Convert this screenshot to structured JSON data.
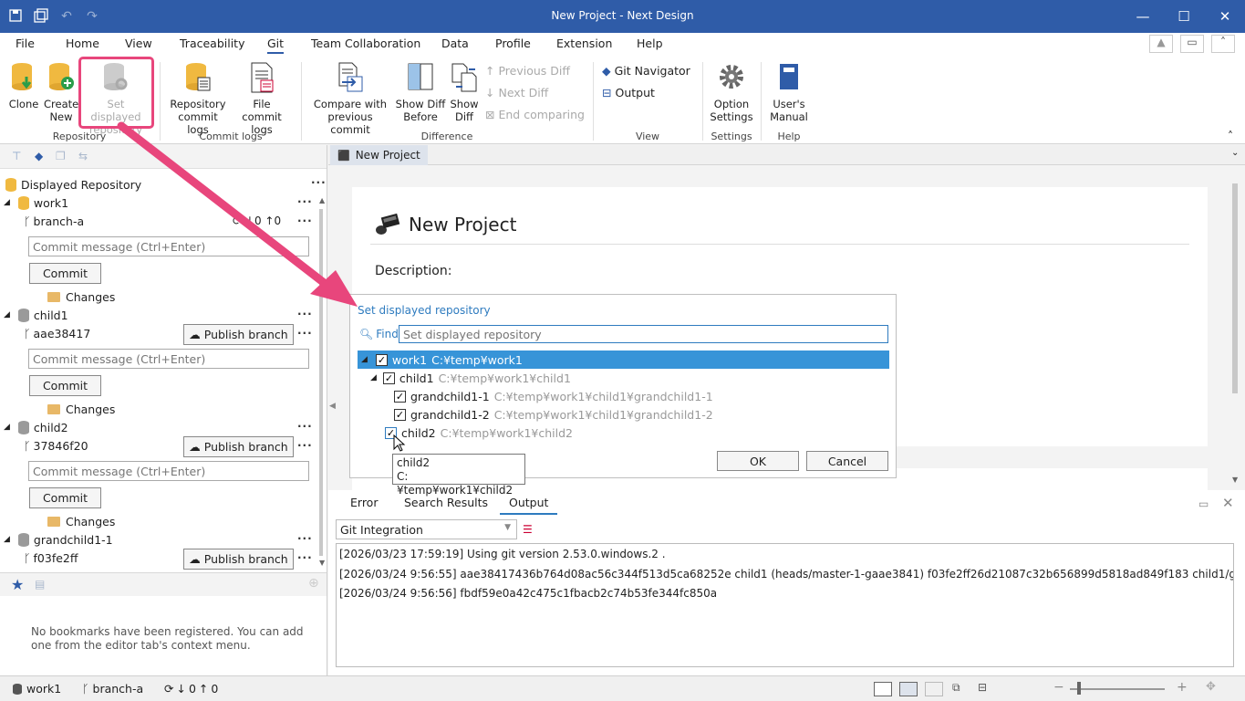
{
  "window": {
    "title": "New Project - Next Design"
  },
  "menu": [
    "File",
    "Home",
    "View",
    "Traceability",
    "Git",
    "Team Collaboration",
    "Data",
    "Profile",
    "Extension",
    "Help"
  ],
  "ribbon": {
    "clone": "Clone",
    "create_new_1": "Create",
    "create_new_2": "New",
    "set_repo_1": "Set displayed",
    "set_repo_2": "repository",
    "repo_logs_1": "Repository",
    "repo_logs_2": "commit logs",
    "file_logs_1": "File commit",
    "file_logs_2": "logs",
    "compare_1": "Compare with",
    "compare_2": "previous commit",
    "show_before_1": "Show Diff",
    "show_before_2": "Before",
    "show_diff_1": "Show",
    "show_diff_2": "Diff",
    "prev_diff": "Previous Diff",
    "next_diff": "Next Diff",
    "end_comparing": "End comparing",
    "git_navigator": "Git Navigator",
    "output": "Output",
    "option_1": "Option",
    "option_2": "Settings",
    "manual_1": "User's",
    "manual_2": "Manual",
    "groups": {
      "repository": "Repository",
      "commit_logs": "Commit logs",
      "difference": "Difference",
      "view": "View",
      "settings": "Settings",
      "help": "Help"
    }
  },
  "left": {
    "header": "Displayed Repository",
    "commit_placeholder": "Commit message (Ctrl+Enter)",
    "commit_label": "Commit",
    "changes_label": "Changes",
    "publish_label": "Publish branch",
    "repos": [
      {
        "name": "work1",
        "branch": "branch-a",
        "down": "0",
        "up": "0"
      },
      {
        "name": "child1",
        "branch": "aae38417"
      },
      {
        "name": "child2",
        "branch": "37846f20"
      },
      {
        "name": "grandchild1-1",
        "branch": "f03fe2ff"
      }
    ],
    "bookmarks_empty": "No bookmarks have been registered. You can add one from the editor tab's context menu."
  },
  "doc": {
    "tab": "New Project",
    "title": "New Project",
    "description_label": "Description:"
  },
  "dialog": {
    "title": "Set displayed repository",
    "find_label": "Find",
    "find_placeholder": "Set displayed repository",
    "rows": [
      {
        "name": "work1",
        "path": "C:¥temp¥work1"
      },
      {
        "name": "child1",
        "path": "C:¥temp¥work1¥child1"
      },
      {
        "name": "grandchild1-1",
        "path": "C:¥temp¥work1¥child1¥grandchild1-1"
      },
      {
        "name": "grandchild1-2",
        "path": "C:¥temp¥work1¥child1¥grandchild1-2"
      },
      {
        "name": "child2",
        "path": "C:¥temp¥work1¥child2"
      }
    ],
    "ok": "OK",
    "cancel": "Cancel",
    "tooltip_name": "child2",
    "tooltip_path": "C:¥temp¥work1¥child2"
  },
  "bottom": {
    "tabs": [
      "Error",
      "Search Results",
      "Output"
    ],
    "source": "Git Integration",
    "lines": [
      "[2026/03/23 17:59:19] Using git version 2.53.0.windows.2 .",
      "[2026/03/24 9:56:55]  aae38417436b764d08ac56c344f513d5ca68252e child1 (heads/master-1-gaae3841)  f03fe2ff26d21087c32b656899d5818ad849f183 child1/gr",
      "[2026/03/24 9:56:56] fbdf59e0a42c475c1fbacb2c74b53fe344fc850a"
    ]
  },
  "status": {
    "repo": "work1",
    "branch": "branch-a",
    "down": "0",
    "up": "0"
  },
  "colors": {
    "title_bar": "#2f5ca8",
    "selection": "#3794d8",
    "highlight_box": "#e8467c",
    "link": "#2e7bbf"
  }
}
